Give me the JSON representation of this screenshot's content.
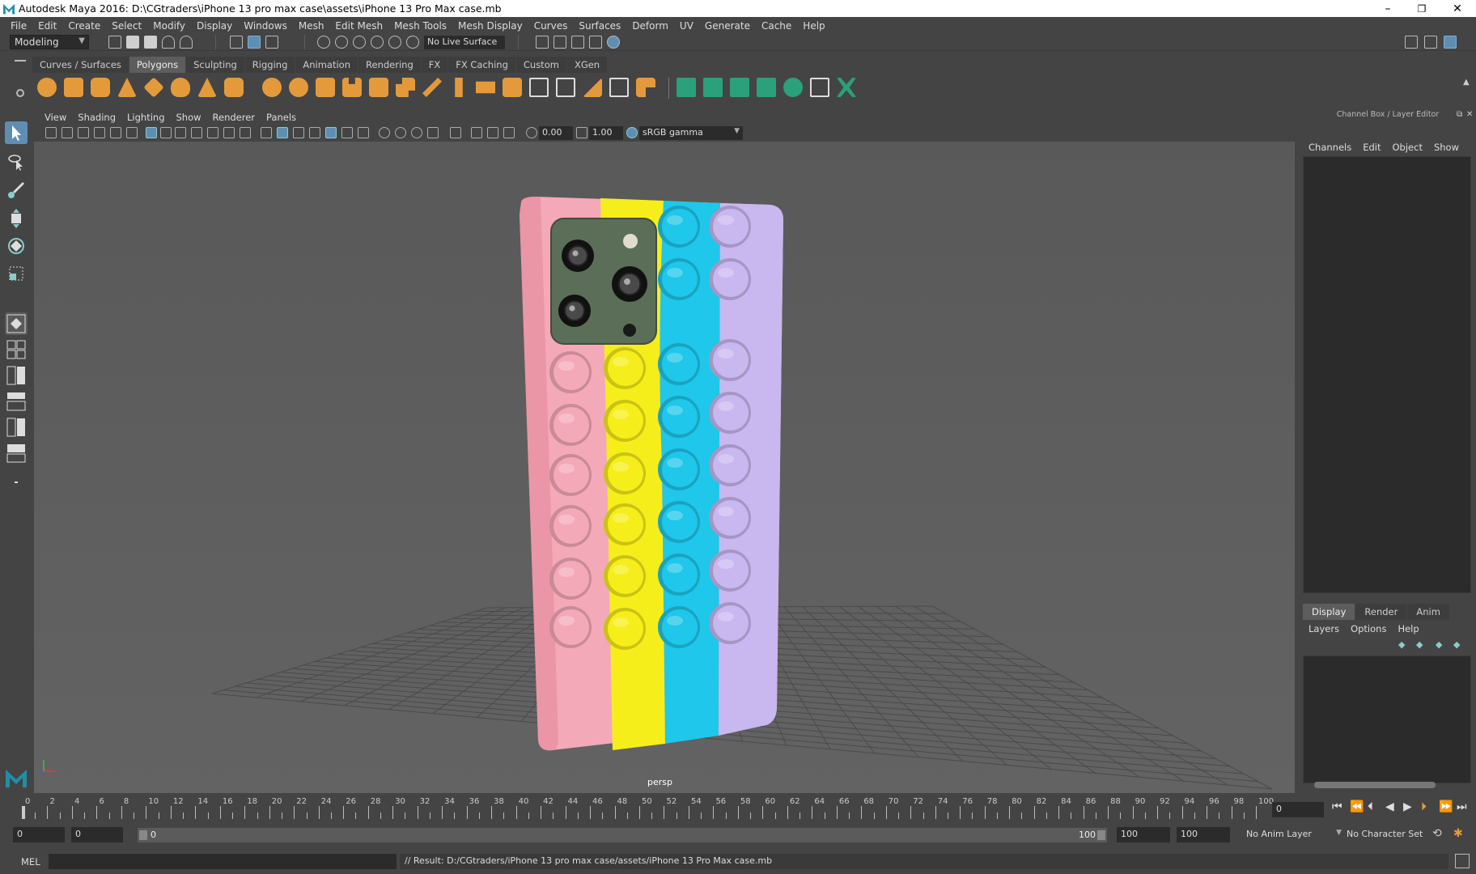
{
  "window": {
    "title": "Autodesk Maya 2016: D:\\CGtraders\\iPhone 13 pro max case\\assets\\iPhone 13 Pro Max case.mb",
    "minimize": "–",
    "maximize": "❐",
    "close": "✕"
  },
  "menubar": [
    "File",
    "Edit",
    "Create",
    "Select",
    "Modify",
    "Display",
    "Windows",
    "Mesh",
    "Edit Mesh",
    "Mesh Tools",
    "Mesh Display",
    "Curves",
    "Surfaces",
    "Deform",
    "UV",
    "Generate",
    "Cache",
    "Help"
  ],
  "statusline": {
    "mode": "Modeling",
    "live_surface": "No Live Surface"
  },
  "shelf": {
    "tabs": [
      "Curves / Surfaces",
      "Polygons",
      "Sculpting",
      "Rigging",
      "Animation",
      "Rendering",
      "FX",
      "FX Caching",
      "Custom",
      "XGen"
    ],
    "active": "Polygons"
  },
  "viewport": {
    "menu": [
      "View",
      "Shading",
      "Lighting",
      "Show",
      "Renderer",
      "Panels"
    ],
    "exposure": "0.00",
    "gamma": "1.00",
    "color_space": "sRGB gamma",
    "camera_label": "persp",
    "case_colors": {
      "pink": "#f4a9b8",
      "yellow": "#f6ee1a",
      "cyan": "#1fc7ea",
      "lavender": "#c9b7ef",
      "camera_island": "#5b6e57"
    }
  },
  "channel_box": {
    "title": "Channel Box / Layer Editor",
    "menu": [
      "Channels",
      "Edit",
      "Object",
      "Show"
    ]
  },
  "layer_editor": {
    "tabs": [
      "Display",
      "Render",
      "Anim"
    ],
    "active": "Display",
    "menu": [
      "Layers",
      "Options",
      "Help"
    ]
  },
  "timeline": {
    "ticks": [
      "0",
      "2",
      "4",
      "6",
      "8",
      "10",
      "12",
      "14",
      "16",
      "18",
      "20",
      "22",
      "24",
      "26",
      "28",
      "30",
      "32",
      "34",
      "36",
      "38",
      "40",
      "42",
      "44",
      "46",
      "48",
      "50",
      "52",
      "54",
      "56",
      "58",
      "60",
      "62",
      "64",
      "66",
      "68",
      "70",
      "72",
      "74",
      "76",
      "78",
      "80",
      "82",
      "84",
      "86",
      "88",
      "90",
      "92",
      "94",
      "96",
      "98",
      "100"
    ],
    "current_frame": "0"
  },
  "range": {
    "start": "0",
    "playback_start": "0",
    "range_start_label": "0",
    "range_end_label": "100",
    "playback_end": "100",
    "end": "100",
    "anim_layer": "No Anim Layer",
    "character_set": "No Character Set"
  },
  "command": {
    "language": "MEL",
    "result": "// Result: D:/CGtraders/iPhone 13 pro max case/assets/iPhone 13 Pro Max case.mb"
  }
}
